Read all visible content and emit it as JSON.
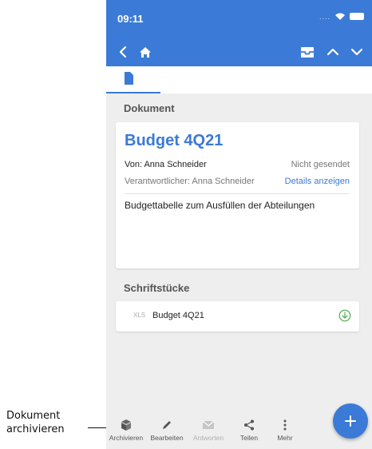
{
  "callout": {
    "line1": "Dokument",
    "line2": "archivieren"
  },
  "status_bar": {
    "time": "09:11"
  },
  "icons": {
    "back": "chevron-left-icon",
    "home": "home-icon",
    "inbox": "inbox-tray-icon",
    "up": "chevron-up-icon",
    "down": "chevron-down-icon",
    "document_tab": "document-icon",
    "download": "download-circle-icon",
    "add": "plus-icon"
  },
  "colors": {
    "brand": "#3b7ad6",
    "download": "#4caf50"
  },
  "document_section": {
    "heading": "Dokument",
    "title": "Budget 4Q21",
    "from": "Von: Anna Schneider",
    "send_status": "Nicht gesendet",
    "responsible": "Verantwortlicher: Anna Schneider",
    "details_link": "Details anzeigen",
    "description": "Budgettabelle zum Ausfüllen der Abteilungen"
  },
  "attachments_section": {
    "heading": "Schriftstücke",
    "items": [
      {
        "type": "XLS",
        "name": "Budget 4Q21"
      }
    ]
  },
  "bottom_bar": {
    "items": [
      {
        "label": "Archivieren",
        "icon": "archive-box-icon",
        "enabled": true
      },
      {
        "label": "Bearbeiten",
        "icon": "pencil-icon",
        "enabled": true
      },
      {
        "label": "Antworten",
        "icon": "envelope-icon",
        "enabled": false
      },
      {
        "label": "Teilen",
        "icon": "share-icon",
        "enabled": true
      },
      {
        "label": "Mehr",
        "icon": "more-vertical-icon",
        "enabled": true
      }
    ]
  }
}
